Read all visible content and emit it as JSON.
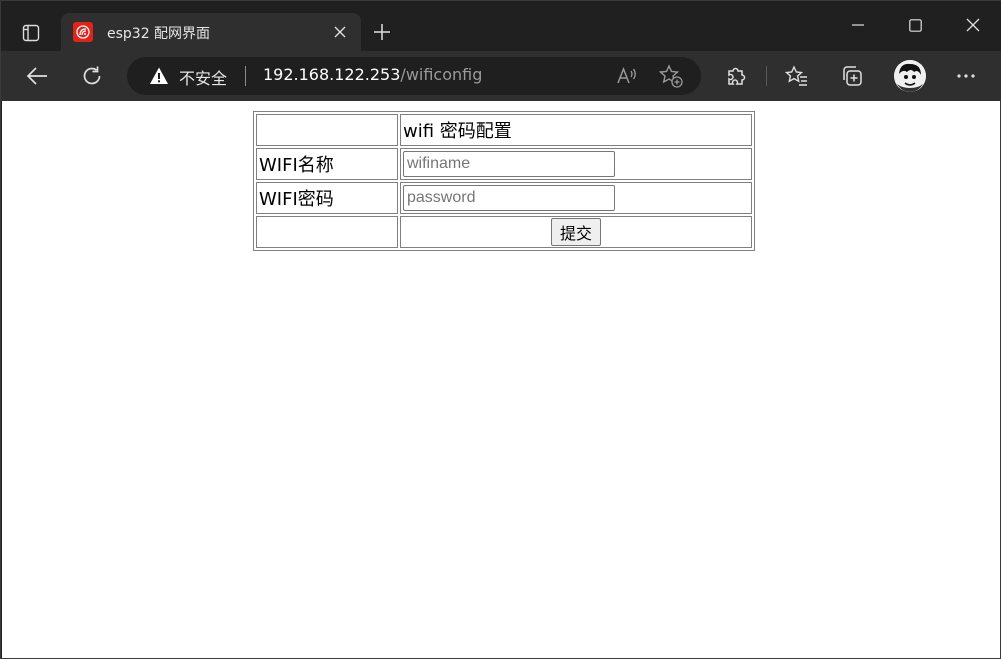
{
  "browser": {
    "tab": {
      "title": "esp32 配网界面",
      "favicon": "espressif-logo-icon"
    },
    "address": {
      "security_label": "不安全",
      "url_host": "192.168.122.253",
      "url_path": "/wificonfig"
    },
    "colors": {
      "tab_bg": "#2f2f2f",
      "titlebar_bg": "#202020",
      "favicon_red": "#e2231a"
    }
  },
  "form": {
    "header": "wifi 密码配置",
    "rows": [
      {
        "label": "WIFI名称",
        "placeholder": "wifiname",
        "value": ""
      },
      {
        "label": "WIFI密码",
        "placeholder": "password",
        "value": ""
      }
    ],
    "submit_label": "提交"
  }
}
